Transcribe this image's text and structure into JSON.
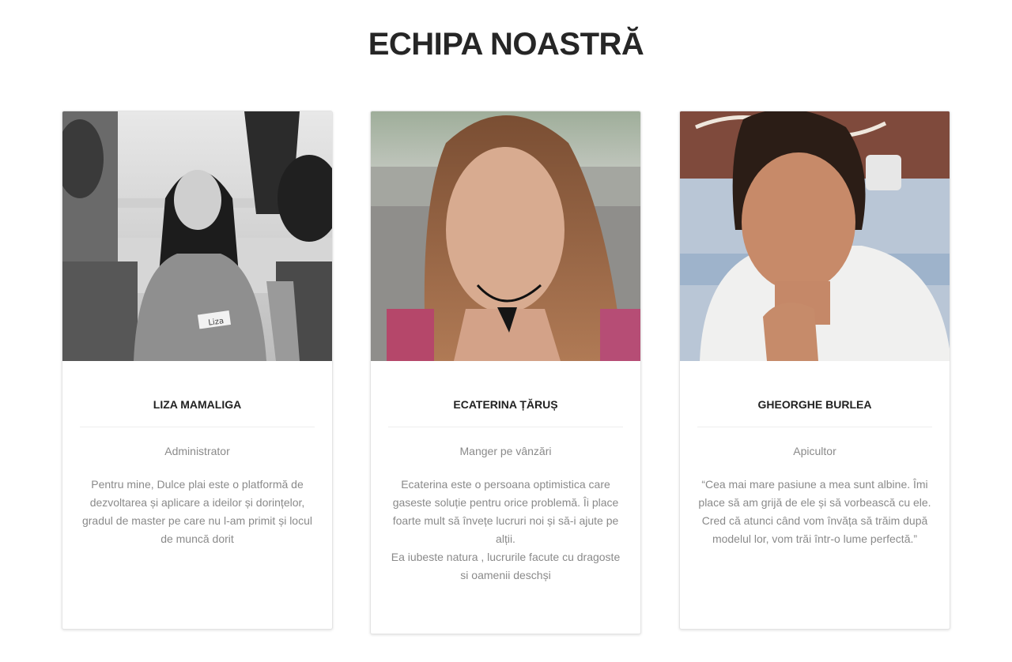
{
  "section": {
    "title": "ECHIPA NOASTRĂ"
  },
  "team": [
    {
      "name": "LIZA MAMALIGA",
      "role": "Administrator",
      "bio": "Pentru mine, Dulce plai este o platformă de dezvoltarea și aplicare a ideilor și dorințelor, gradul de master pe care nu l-am primit și locul de muncă dorit",
      "photo_tag": "Liza"
    },
    {
      "name": "ECATERINA ȚĂRUȘ",
      "role": "Manger pe vânzări",
      "bio_lines": [
        "Ecaterina este o persoana optimistica care gaseste soluție pentru orice problemă. Îi place foarte mult să învețe lucruri noi și să-i ajute pe alții.",
        "Ea iubeste natura , lucrurile facute cu dragoste si oamenii deschși"
      ]
    },
    {
      "name": "GHEORGHE BURLEA",
      "role": "Apicultor",
      "bio": "“Cea mai mare pasiune a mea sunt albine. Îmi place să am grijă de ele și să vorbească cu ele. Cred că atunci când vom învăța să trăim după modelul lor, vom trăi într-o lume perfectă.”"
    }
  ]
}
